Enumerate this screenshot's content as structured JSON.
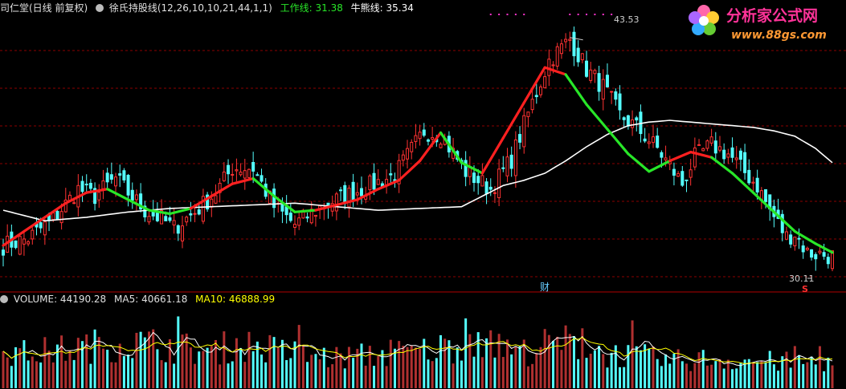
{
  "header": {
    "stock_title": "司仁堂(日线 前复权)",
    "indicator_name": "徐氏持股线(12,26,10,10,21,44,1,1)",
    "work_line_label": "工作线: 31.38",
    "bull_line_label": "牛熊线: 35.34"
  },
  "volume_header": {
    "volume_label": "VOLUME: 44190.28",
    "ma5_label": "MA5: 40661.18",
    "ma10_label": "MA10: 46888.99"
  },
  "annotations": {
    "high_label": "43.53",
    "low_label": "30.11",
    "cai_marker": "财",
    "s_marker": "S"
  },
  "logo": {
    "text": "分析家公式网",
    "url": "www.88gs.com"
  },
  "colors": {
    "background": "#000000",
    "up_candle": "#ff3232",
    "down_candle": "#54ffff",
    "work_line_up": "#ff2020",
    "work_line_down": "#28e628",
    "bull_line": "#ffffff",
    "grid": "#8b0000",
    "ma5": "#ffffff",
    "ma10": "#ffff00",
    "header_title": "#e0e0e0",
    "work_label": "#28e628"
  },
  "chart_data": {
    "type": "candlestick",
    "price_anchors": {
      "x": [
        0,
        6,
        12,
        18,
        22,
        27,
        30,
        34,
        38,
        41,
        46,
        51,
        55,
        60,
        65,
        70,
        77,
        84,
        94,
        101,
        105,
        111,
        117,
        122,
        126,
        131,
        136,
        140,
        144,
        148,
        152,
        157,
        163,
        166,
        170,
        174,
        177,
        181,
        184,
        188,
        190,
        193,
        199
      ],
      "close": [
        31.8,
        32.2,
        33.3,
        35.0,
        34.6,
        35.6,
        34.8,
        33.8,
        33.3,
        32.8,
        33.7,
        34.8,
        36.2,
        36.2,
        34.0,
        33.0,
        34.1,
        34.8,
        35.8,
        38.3,
        38.1,
        36.0,
        35.0,
        36.7,
        39.3,
        42.3,
        43.5,
        41.8,
        40.8,
        39.2,
        38.5,
        37.3,
        35.3,
        36.8,
        37.5,
        37.0,
        36.2,
        35.2,
        33.8,
        32.3,
        32.5,
        31.4,
        31.2
      ]
    },
    "work_line": {
      "x": [
        0,
        5,
        10,
        15,
        20,
        25,
        30,
        35,
        40,
        45,
        50,
        55,
        60,
        65,
        70,
        75,
        80,
        85,
        90,
        95,
        100,
        105,
        110,
        115,
        120,
        125,
        130,
        135,
        140,
        145,
        150,
        155,
        160,
        165,
        170,
        175,
        180,
        185,
        190,
        195,
        199
      ],
      "y": [
        31.8,
        32.6,
        33.4,
        34.2,
        34.8,
        35.0,
        34.4,
        33.8,
        33.6,
        33.9,
        34.6,
        35.3,
        35.6,
        34.6,
        33.7,
        33.8,
        34.1,
        34.4,
        35.0,
        35.5,
        36.6,
        38.2,
        36.5,
        35.9,
        37.9,
        39.9,
        41.9,
        41.5,
        39.8,
        38.4,
        37.0,
        36.0,
        36.6,
        37.1,
        36.8,
        35.9,
        34.8,
        33.7,
        32.6,
        31.9,
        31.4
      ],
      "color_flag_by_segment": [
        "up",
        "up",
        "up",
        "up",
        "up",
        "down",
        "down",
        "down",
        "down",
        "up",
        "up",
        "up",
        "down",
        "down",
        "down",
        "up",
        "up",
        "up",
        "up",
        "up",
        "up",
        "down",
        "down",
        "up",
        "up",
        "up",
        "up",
        "down",
        "down",
        "down",
        "down",
        "down",
        "up",
        "up",
        "down",
        "down",
        "down",
        "down",
        "down",
        "down"
      ]
    },
    "bull_line": {
      "x": [
        0,
        10,
        20,
        30,
        40,
        50,
        60,
        70,
        80,
        90,
        100,
        110,
        115,
        120,
        125,
        130,
        135,
        140,
        145,
        150,
        155,
        160,
        165,
        170,
        175,
        180,
        185,
        190,
        195,
        199
      ],
      "y": [
        33.8,
        33.2,
        33.4,
        33.7,
        33.9,
        34.0,
        34.1,
        34.2,
        34.0,
        33.8,
        33.9,
        34.0,
        34.6,
        35.2,
        35.5,
        35.9,
        36.6,
        37.4,
        38.1,
        38.6,
        38.8,
        38.9,
        38.8,
        38.7,
        38.6,
        38.5,
        38.3,
        38.0,
        37.3,
        36.5
      ]
    },
    "volume_anchors": {
      "x": [
        0,
        10,
        20,
        30,
        40,
        50,
        55,
        60,
        70,
        80,
        90,
        100,
        108,
        113,
        118,
        125,
        130,
        135,
        140,
        145,
        150,
        160,
        170,
        180,
        190,
        199
      ],
      "y": [
        55000,
        60000,
        68000,
        75000,
        70000,
        58000,
        72000,
        70000,
        55000,
        50000,
        55000,
        60000,
        70000,
        85000,
        65000,
        60000,
        70000,
        75000,
        70000,
        55000,
        55000,
        45000,
        48000,
        45000,
        42000,
        44190
      ]
    },
    "price_ylim": [
      29.8,
      45.0
    ],
    "volume_ylim": [
      0,
      130000
    ],
    "grid": true,
    "bars": 200
  }
}
